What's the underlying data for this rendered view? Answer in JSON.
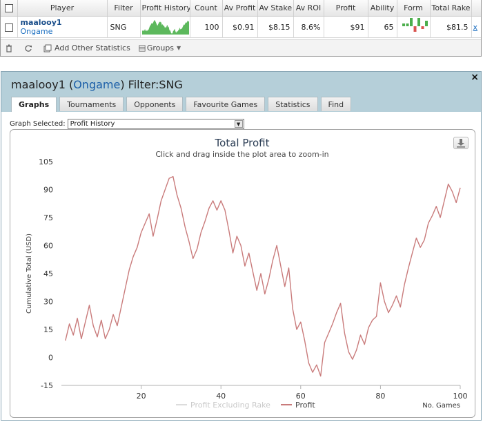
{
  "stats": {
    "headers": [
      "Player",
      "Filter",
      "Profit History",
      "Count",
      "Av Profit",
      "Av Stake",
      "Av ROI",
      "Profit",
      "Ability",
      "Form",
      "Total Rake"
    ],
    "row": {
      "player_name": "maalooy1",
      "site": "Ongame",
      "filter": "SNG",
      "count": "100",
      "av_profit": "$0.91",
      "av_stake": "$8.15",
      "av_roi": "8.6%",
      "profit": "$91",
      "ability": "65",
      "total_rake": "$81.5",
      "remove": "x"
    },
    "form_bars": [
      1,
      1,
      3,
      -2,
      3,
      -1,
      2
    ],
    "toolbar": {
      "add_other_label": "Add Other Statistics",
      "groups_label": "Groups"
    }
  },
  "panel": {
    "player": "maalooy1",
    "site": "Ongame",
    "filter_label": "Filter:SNG",
    "close": "×",
    "tabs": [
      "Graphs",
      "Tournaments",
      "Opponents",
      "Favourite Games",
      "Statistics",
      "Find"
    ],
    "active_tab": "Graphs",
    "graph_selected_label": "Graph Selected:",
    "graph_selected_value": "Profit History"
  },
  "colors": {
    "profit_line": "#c97b7b",
    "profit_excl_rake_line": "#dcdcdc",
    "header_bg": "#b5cfd9",
    "sparkline": "#5cb85c",
    "form_positive": "#4cae4c",
    "form_negative": "#d9534f"
  },
  "chart_data": {
    "type": "line",
    "title": "Total Profit",
    "subtitle": "Click and drag inside the plot area to zoom-in",
    "xlabel": "No. Games",
    "ylabel": "Cumulative Total (USD)",
    "xlim": [
      0,
      100
    ],
    "ylim": [
      -15,
      105
    ],
    "x_ticks": [
      20,
      40,
      60,
      80,
      100
    ],
    "y_ticks": [
      105,
      90,
      75,
      60,
      45,
      30,
      15,
      0,
      -15
    ],
    "legend": [
      "Profit Excluding Rake",
      "Profit"
    ],
    "legend_position": "bottom-center",
    "series": [
      {
        "name": "Profit",
        "x": [
          1,
          2,
          3,
          4,
          5,
          6,
          7,
          8,
          9,
          10,
          11,
          12,
          13,
          14,
          15,
          16,
          17,
          18,
          19,
          20,
          21,
          22,
          23,
          24,
          25,
          26,
          27,
          28,
          29,
          30,
          31,
          32,
          33,
          34,
          35,
          36,
          37,
          38,
          39,
          40,
          41,
          42,
          43,
          44,
          45,
          46,
          47,
          48,
          49,
          50,
          51,
          52,
          53,
          54,
          55,
          56,
          57,
          58,
          59,
          60,
          61,
          62,
          63,
          64,
          65,
          66,
          67,
          68,
          69,
          70,
          71,
          72,
          73,
          74,
          75,
          76,
          77,
          78,
          79,
          80,
          81,
          82,
          83,
          84,
          85,
          86,
          87,
          88,
          89,
          90,
          91,
          92,
          93,
          94,
          95,
          96,
          97,
          98,
          99,
          100
        ],
        "values": [
          9,
          18,
          12,
          21,
          10,
          19,
          28,
          17,
          11,
          20,
          10,
          15,
          23,
          17,
          27,
          37,
          47,
          54,
          59,
          67,
          72,
          77,
          65,
          74,
          84,
          90,
          96,
          97,
          87,
          80,
          70,
          62,
          53,
          58,
          67,
          73,
          80,
          84,
          79,
          84,
          79,
          68,
          56,
          65,
          60,
          49,
          56,
          46,
          36,
          45,
          34,
          42,
          52,
          60,
          49,
          38,
          48,
          26,
          15,
          19,
          9,
          -3,
          -8,
          -4,
          -10,
          8,
          13,
          18,
          24,
          29,
          13,
          3,
          -1,
          4,
          12,
          7,
          16,
          20,
          22,
          40,
          30,
          24,
          28,
          33,
          27,
          39,
          48,
          56,
          64,
          59,
          63,
          72,
          76,
          81,
          75,
          84,
          93,
          89,
          83,
          91
        ]
      },
      {
        "name": "Profit Excluding Rake",
        "values": []
      }
    ]
  }
}
